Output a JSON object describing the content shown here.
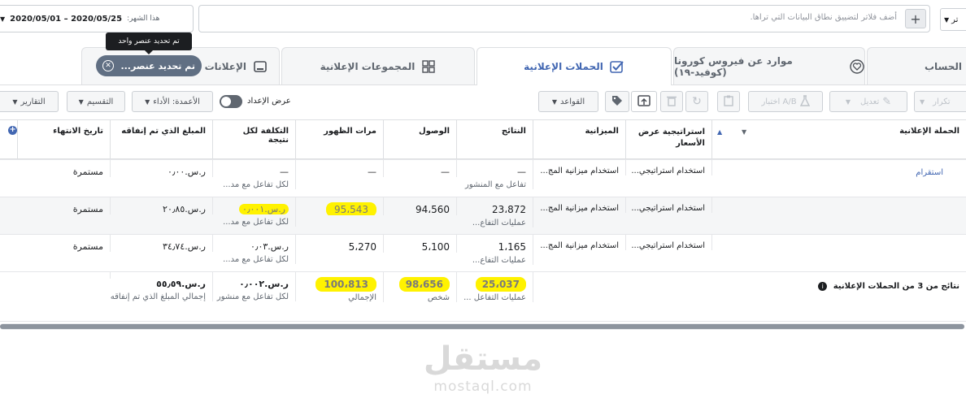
{
  "topbar": {
    "date_prefix": "هذا الشهر:",
    "date_range": "2020/05/01 – 2020/05/25",
    "filter_hint": "أضف فلاتر لتضييق نطاق البيانات التي تراها.",
    "add_label": "+",
    "right_dropdown": "تر"
  },
  "tooltip": {
    "text": "تم تحديد عنصر واحد"
  },
  "tabs": {
    "selection_pill": "تم تحديد عنصر...",
    "ads": "الإعلانات",
    "adsets": "المجموعات الإعلانية",
    "campaigns": "الحملات الإعلانية",
    "covid": "موارد عن فيروس كورونا (كوفيد-١٩)",
    "account": "الحساب"
  },
  "toolbar": {
    "reports": "التقارير",
    "breakdown": "التقسيم",
    "columns": "الأعمدة: الأداء",
    "toggle_label": "عرض الإعداد",
    "rules": "القواعد",
    "ab_test": "اختبار A/B",
    "edit": "تعديل",
    "duplicate": "تكرار"
  },
  "columns": {
    "end_date": "تاريخ الانتهاء",
    "amount_spent": "المبلغ الذي تم إنفاقه",
    "cost_per_result": "التكلفة لكل نتيجة",
    "impressions": "مرات الظهور",
    "reach": "الوصول",
    "results": "النتائج",
    "budget": "الميزانية",
    "bid_strategy": "استراتيجية عرض الأسعار",
    "campaign_name": "الحملة الإعلانية"
  },
  "rows": [
    {
      "end_date": "مستمرة",
      "amount_spent": "ر.س.٠٫٠٠",
      "cost_per_result": "—",
      "cost_sub": "لكل تفاعل مع مد...",
      "impressions": "—",
      "reach": "—",
      "results": "—",
      "results_sub": "تفاعل مع المنشور",
      "budget": "استخدام ميزانية المج...",
      "bid_strategy": "استخدام استراتيجي...",
      "campaign_link": "استقرام"
    },
    {
      "end_date": "مستمرة",
      "amount_spent": "ر.س.٢٠٫٨٥",
      "cost_per_result": "ر.س.٠٫٠٠١",
      "cost_sub": "لكل تفاعل مع مد...",
      "impressions": "95،543",
      "reach": "94،560",
      "results": "23،872",
      "results_sub": "عمليات التفاع...",
      "budget": "استخدام ميزانية المج...",
      "bid_strategy": "استخدام استراتيجي..."
    },
    {
      "end_date": "مستمرة",
      "amount_spent": "ر.س.٣٤٫٧٤",
      "cost_per_result": "ر.س.٠٫٠٣",
      "cost_sub": "لكل تفاعل مع مد...",
      "impressions": "5،270",
      "reach": "5،100",
      "results": "1،165",
      "results_sub": "عمليات التفاع...",
      "budget": "استخدام ميزانية المج...",
      "bid_strategy": "استخدام استراتيجي..."
    }
  ],
  "totals": {
    "label": "نتائج من 3 من الحملات الإعلانية",
    "amount_spent": "ر.س.٥٥٫٥٩",
    "amount_sub": "إجمالي المبلغ الذي تم إنفاقه",
    "cost_per_result": "ر.س.٠٫٠٠٢",
    "cost_sub": "لكل تفاعل مع منشور",
    "impressions": "100،813",
    "impressions_sub": "الإجمالي",
    "reach": "98،656",
    "reach_sub": "شخص",
    "results": "25،037",
    "results_sub": "عمليات التفاعل ..."
  },
  "watermark": {
    "arabic": "مستقل",
    "latin": "mostaql.com"
  },
  "colors": {
    "highlight": "#fff200",
    "accent": "#4267b2"
  }
}
